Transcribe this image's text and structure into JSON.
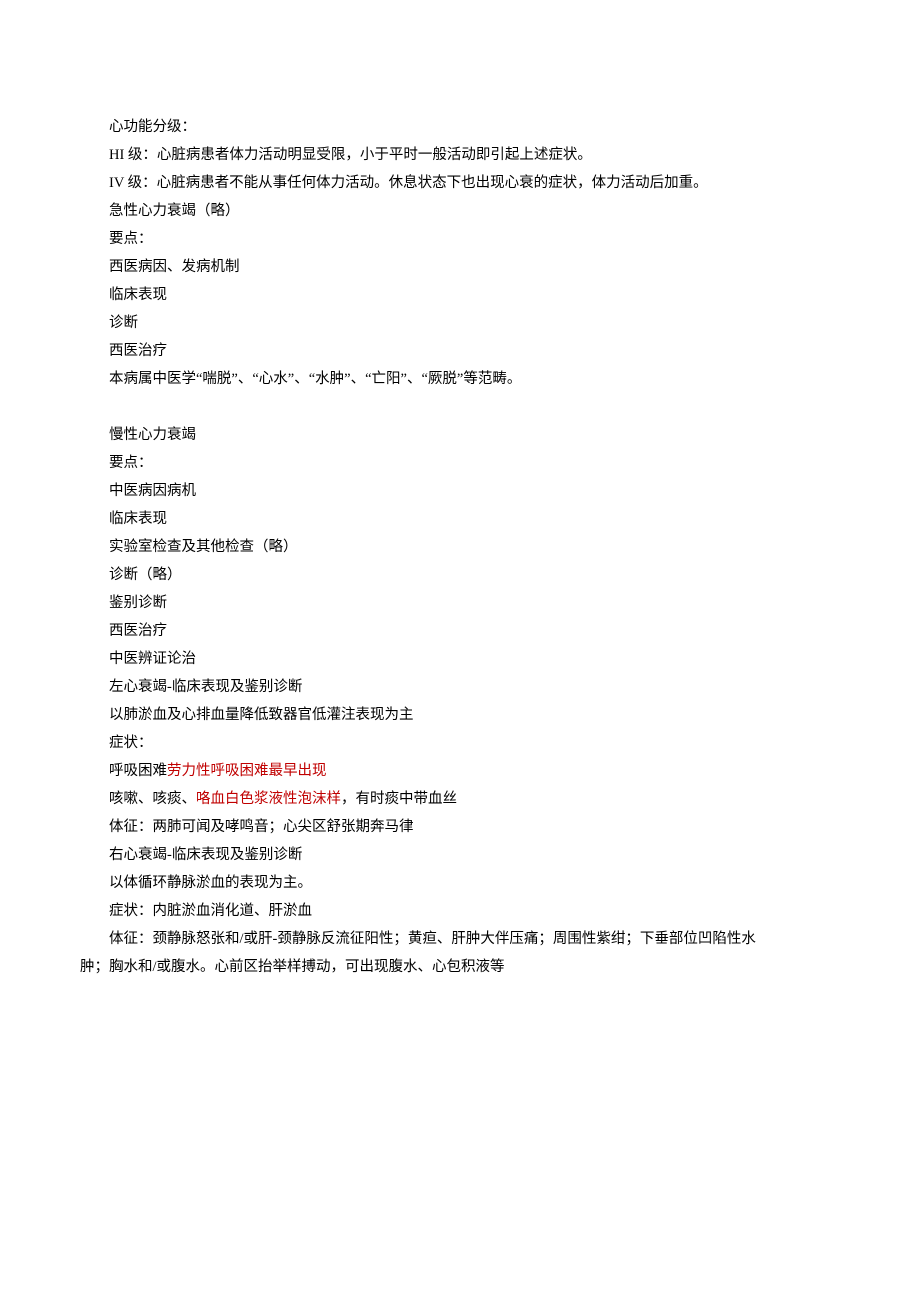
{
  "lines": [
    {
      "indent": true,
      "segments": [
        {
          "text": "心功能分级："
        }
      ]
    },
    {
      "indent": true,
      "segments": [
        {
          "text": "HI 级：心脏病患者体力活动明显受限，小于平时一般活动即引起上述症状。"
        }
      ]
    },
    {
      "indent": true,
      "segments": [
        {
          "text": "IV 级：心脏病患者不能从事任何体力活动。休息状态下也出现心衰的症状，体力活动后加重。"
        }
      ]
    },
    {
      "indent": true,
      "segments": [
        {
          "text": "急性心力衰竭（略）"
        }
      ]
    },
    {
      "indent": true,
      "segments": [
        {
          "text": "要点："
        }
      ]
    },
    {
      "indent": true,
      "segments": [
        {
          "text": "西医病因、发病机制"
        }
      ]
    },
    {
      "indent": true,
      "segments": [
        {
          "text": "临床表现"
        }
      ]
    },
    {
      "indent": true,
      "segments": [
        {
          "text": "诊断"
        }
      ]
    },
    {
      "indent": true,
      "segments": [
        {
          "text": "西医治疗"
        }
      ]
    },
    {
      "indent": true,
      "segments": [
        {
          "text": "本病属中医学“喘脱”、“心水”、“水肿”、“亡阳”、“厥脱”等范畴。"
        }
      ]
    },
    {
      "blank": true
    },
    {
      "indent": true,
      "segments": [
        {
          "text": "慢性心力衰竭"
        }
      ]
    },
    {
      "indent": true,
      "segments": [
        {
          "text": "要点："
        }
      ]
    },
    {
      "indent": true,
      "segments": [
        {
          "text": "中医病因病机"
        }
      ]
    },
    {
      "indent": true,
      "segments": [
        {
          "text": "临床表现"
        }
      ]
    },
    {
      "indent": true,
      "segments": [
        {
          "text": "实验室检查及其他检查（略）"
        }
      ]
    },
    {
      "indent": true,
      "segments": [
        {
          "text": "诊断（略）"
        }
      ]
    },
    {
      "indent": true,
      "segments": [
        {
          "text": "鉴别诊断"
        }
      ]
    },
    {
      "indent": true,
      "segments": [
        {
          "text": "西医治疗"
        }
      ]
    },
    {
      "indent": true,
      "segments": [
        {
          "text": "中医辨证论治"
        }
      ]
    },
    {
      "indent": true,
      "segments": [
        {
          "text": "左心衰竭-临床表现及鉴别诊断"
        }
      ]
    },
    {
      "indent": true,
      "segments": [
        {
          "text": "以肺淤血及心排血量降低致器官低灌注表现为主"
        }
      ]
    },
    {
      "indent": true,
      "segments": [
        {
          "text": "症状："
        }
      ]
    },
    {
      "indent": true,
      "segments": [
        {
          "text": "呼吸困难"
        },
        {
          "text": "劳力性呼吸困难最早出现",
          "red": true
        }
      ]
    },
    {
      "indent": true,
      "segments": [
        {
          "text": "咳嗽、咳痰、"
        },
        {
          "text": "咯血白色浆液性泡沫样",
          "red": true
        },
        {
          "text": "，有时痰中带血丝"
        }
      ]
    },
    {
      "indent": true,
      "segments": [
        {
          "text": "体征：两肺可闻及哮鸣音；心尖区舒张期奔马律"
        }
      ]
    },
    {
      "indent": true,
      "segments": [
        {
          "text": "右心衰竭-临床表现及鉴别诊断"
        }
      ]
    },
    {
      "indent": true,
      "segments": [
        {
          "text": "以体循环静脉淤血的表现为主。"
        }
      ]
    },
    {
      "indent": true,
      "segments": [
        {
          "text": "症状：内脏淤血消化道、肝淤血"
        }
      ]
    },
    {
      "indent": true,
      "segments": [
        {
          "text": "体征：颈静脉怒张和/或肝-颈静脉反流征阳性；黄疸、肝肿大伴压痛；周围性紫绀；下垂部位凹陷性水"
        }
      ]
    },
    {
      "indent": false,
      "segments": [
        {
          "text": "肿；胸水和/或腹水。心前区抬举样搏动，可出现腹水、心包积液等"
        }
      ]
    }
  ]
}
